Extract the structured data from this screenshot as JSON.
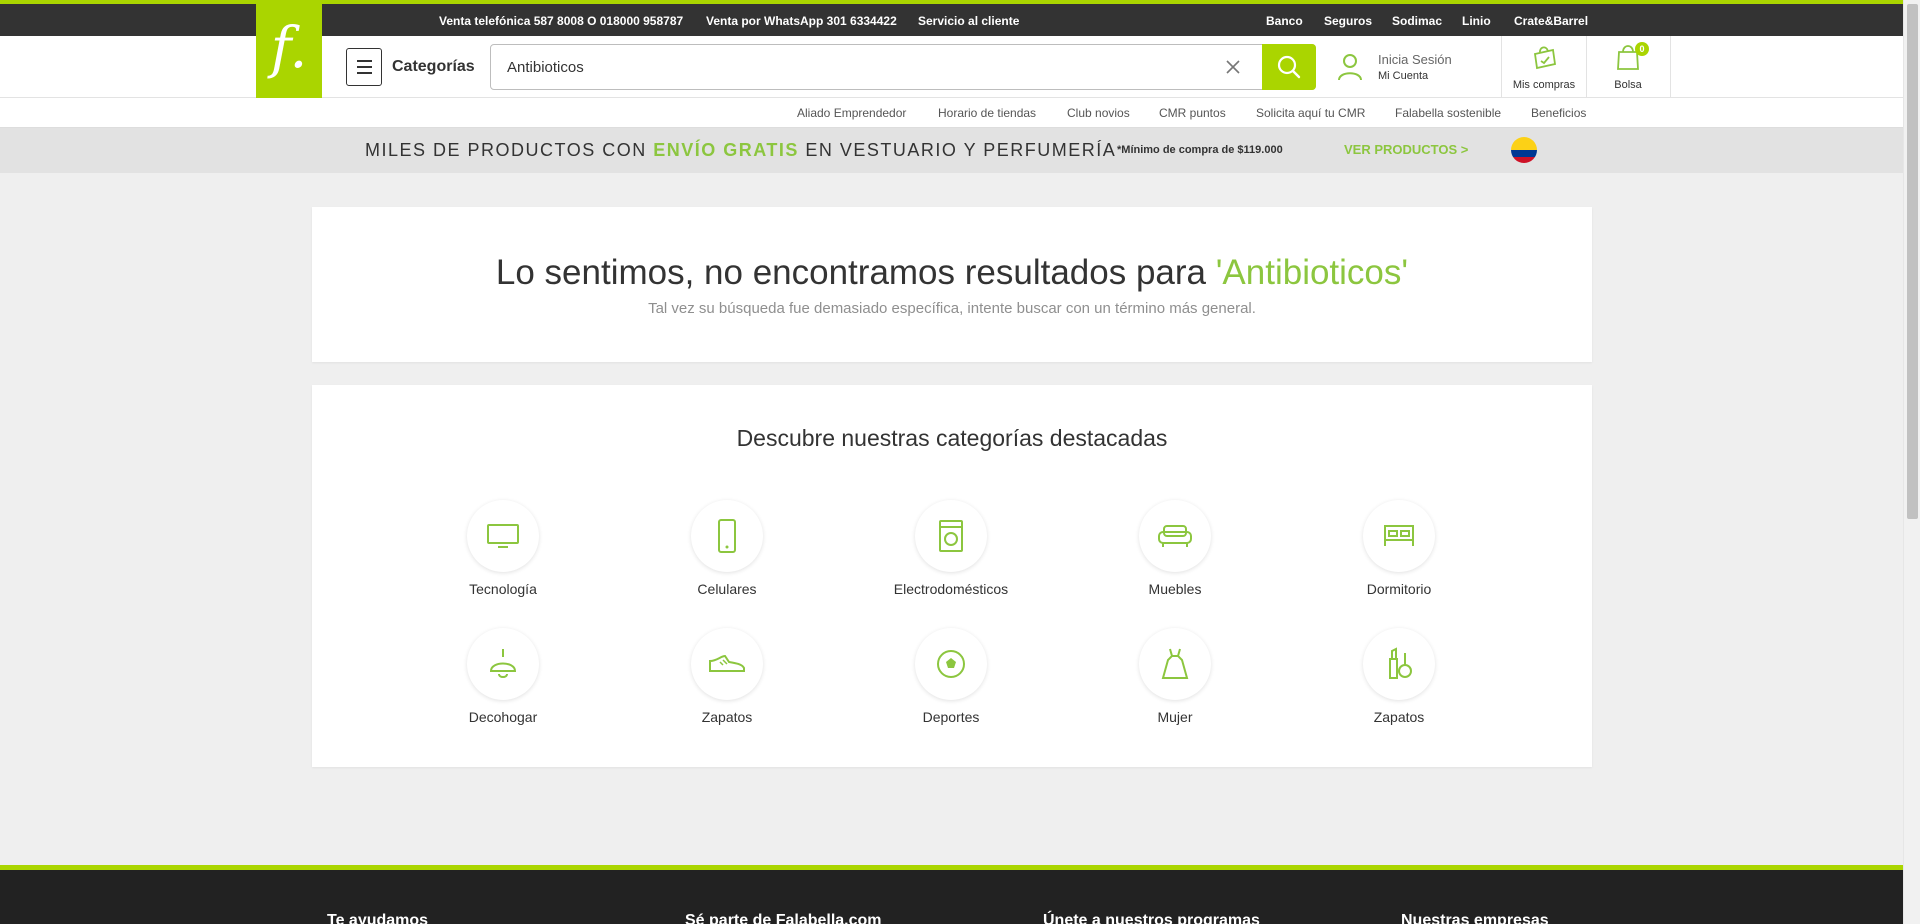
{
  "topbar": {
    "left_links": [
      "Venta telefónica 587 8008 O 018000 958787",
      "Venta por WhatsApp 301 6334422",
      "Servicio al cliente"
    ],
    "right_links": [
      "Banco",
      "Seguros",
      "Sodimac",
      "Linio",
      "Crate&Barrel"
    ]
  },
  "logo": {
    "glyph": "f."
  },
  "header": {
    "categories_label": "Categorías",
    "search_value": "Antibioticos",
    "account_line1": "Inicia Sesión",
    "account_line2": "Mi Cuenta",
    "purchases_label": "Mis compras",
    "bag_label": "Bolsa",
    "bag_count": "0"
  },
  "subnav": [
    "Aliado Emprendedor",
    "Horario de tiendas",
    "Club novios",
    "CMR puntos",
    "Solicita aquí tu CMR",
    "Falabella sostenible",
    "Beneficios"
  ],
  "promo": {
    "text_before": "MILES DE PRODUCTOS CON ",
    "highlight": "ENVÍO GRATIS",
    "text_after": " EN VESTUARIO Y PERFUMERÍA",
    "note": "*Mínimo de compra de $119.000",
    "cta": "VER PRODUCTOS >",
    "flag_colors": [
      "#fcd116",
      "#003893",
      "#ce1126"
    ]
  },
  "no_results": {
    "title_prefix": "Lo sentimos, no encontramos resultados para ",
    "title_term": "'Antibioticos'",
    "subtitle": "Tal vez su búsqueda fue demasiado específica, intente buscar con un término más general."
  },
  "featured": {
    "title": "Descubre nuestras categorías destacadas",
    "items": [
      {
        "label": "Tecnología",
        "icon": "tv-icon"
      },
      {
        "label": "Celulares",
        "icon": "smartphone-icon"
      },
      {
        "label": "Electrodomésticos",
        "icon": "washing-machine-icon"
      },
      {
        "label": "Muebles",
        "icon": "sofa-icon"
      },
      {
        "label": "Dormitorio",
        "icon": "bed-icon"
      },
      {
        "label": "Decohogar",
        "icon": "lamp-icon"
      },
      {
        "label": "Zapatos",
        "icon": "sneaker-icon"
      },
      {
        "label": "Deportes",
        "icon": "soccer-ball-icon"
      },
      {
        "label": "Mujer",
        "icon": "dress-icon"
      },
      {
        "label": "Zapatos",
        "icon": "cosmetics-icon"
      }
    ]
  },
  "footer": {
    "columns": [
      "Te ayudamos",
      "Sé parte de Falabella.com",
      "Únete a nuestros programas",
      "Nuestras empresas"
    ]
  },
  "colors": {
    "accent": "#aad500",
    "accent_text": "#8cc63f",
    "dark": "#333333"
  }
}
